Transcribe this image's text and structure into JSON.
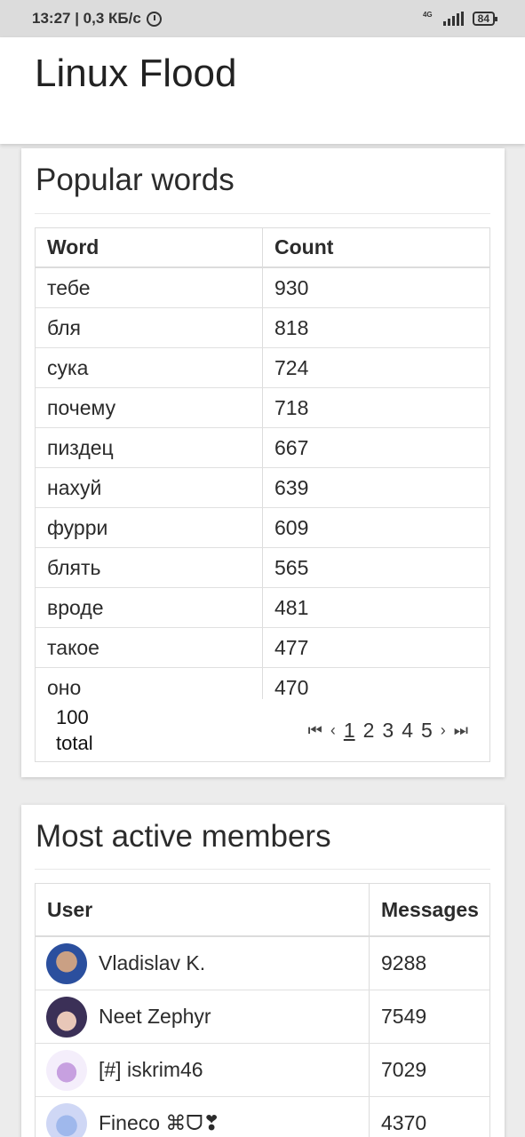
{
  "status_bar": {
    "time_speed": "13:27 | 0,3 КБ/с",
    "network": "4G",
    "battery": "84"
  },
  "app": {
    "title": "Linux Flood"
  },
  "popular_words": {
    "title": "Popular words",
    "headers": {
      "word": "Word",
      "count": "Count"
    },
    "rows": [
      {
        "word": "тебе",
        "count": "930"
      },
      {
        "word": "бля",
        "count": "818"
      },
      {
        "word": "сука",
        "count": "724"
      },
      {
        "word": "почему",
        "count": "718"
      },
      {
        "word": "пиздец",
        "count": "667"
      },
      {
        "word": "нахуй",
        "count": "639"
      },
      {
        "word": "фурри",
        "count": "609"
      },
      {
        "word": "блять",
        "count": "565"
      },
      {
        "word": "вроде",
        "count": "481"
      },
      {
        "word": "такое",
        "count": "477"
      },
      {
        "word": "оно",
        "count": "470"
      }
    ],
    "total_count": "100",
    "total_label": "total",
    "pager": {
      "first": "⏮",
      "prev": "‹",
      "pages": [
        "1",
        "2",
        "3",
        "4",
        "5"
      ],
      "current": "1",
      "next": "›",
      "last": "⏭"
    }
  },
  "most_active": {
    "title": "Most active members",
    "headers": {
      "user": "User",
      "messages": "Messages"
    },
    "rows": [
      {
        "user": "Vladislav K.",
        "messages": "9288",
        "avatar": "avatar-photo"
      },
      {
        "user": "Neet Zephyr",
        "messages": "7549",
        "avatar": "avatar-anime"
      },
      {
        "user": "[#] iskrim46",
        "messages": "7029",
        "avatar": "avatar-pony"
      },
      {
        "user": "Fineco ⌘ᗜ❣",
        "messages": "4370",
        "avatar": "avatar-anime-blue"
      }
    ]
  }
}
